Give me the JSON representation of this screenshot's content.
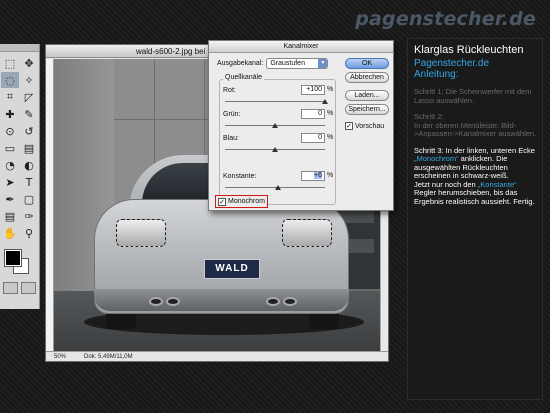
{
  "watermark": "pagenstecher.de",
  "document": {
    "title": "wald-s600-2.jpg bei 5",
    "status_zoom": "50%",
    "status_doc": "Dok: 5,49M/11,0M"
  },
  "scene": {
    "plate_text": "WALD"
  },
  "dialog": {
    "title": "Kanalmixer",
    "output_label": "Ausgabekanal:",
    "output_value": "Graustufen",
    "group_label": "Quellkanäle",
    "red_label": "Rot:",
    "red_value": "+100",
    "green_label": "Grün:",
    "green_value": "0",
    "blue_label": "Blau:",
    "blue_value": "0",
    "constant_label": "Konstante:",
    "constant_value": "+6",
    "percent": "%",
    "ok_label": "OK",
    "cancel_label": "Abbrechen",
    "load_label": "Laden...",
    "save_label": "Speichern...",
    "preview_label": "Vorschau",
    "preview_checked": true,
    "mono_label": "Monochrom",
    "mono_checked": true,
    "check_mark": "✓"
  },
  "panel": {
    "title": "Klarglas Rückleuchten",
    "subtitle_line1": "Pagenstecher.de",
    "subtitle_line2": "Anleitung:",
    "step1_title": "Schritt 1: Die Scheinwerfer mit dem Lasso auswählen.",
    "step2_title": "Schritt 2:",
    "step2_text": "In der oberen Menüleiste: Bild->Anpassen->Kanalmixer auswählen.",
    "step3_a": "Schritt 3: In der linken, unteren Ecke ",
    "step3_hl": "„Monochrom“",
    "step3_b": " anklicken. Die ausgewählten Rückleuchten erscheinen in schwarz-weiß.",
    "step4_a": "Jetzt nur noch den ",
    "step4_hl": "„Konstante“",
    "step4_b": " Regler herumschieben, bis das Ergebnis realistisch aussieht. Fertig."
  },
  "colors": {
    "accent": "#34a9e8",
    "highlight_red": "#d01818",
    "background": "#1b1b1b"
  },
  "tools": {
    "icons": [
      "marquee-icon",
      "move-icon",
      "lasso-icon",
      "magic-wand-icon",
      "crop-icon",
      "slice-icon",
      "healing-icon",
      "brush-icon",
      "stamp-icon",
      "history-brush-icon",
      "eraser-icon",
      "gradient-icon",
      "blur-icon",
      "dodge-icon",
      "path-select-icon",
      "type-icon",
      "pen-icon",
      "shape-icon",
      "notes-icon",
      "eyedropper-icon",
      "hand-icon",
      "zoom-icon"
    ],
    "glyphs": [
      "⬚",
      "✥",
      "◌",
      "✧",
      "⌗",
      "◸",
      "✚",
      "✎",
      "⊙",
      "↺",
      "▭",
      "▤",
      "◔",
      "◐",
      "➤",
      "T",
      "✒",
      "▢",
      "▤",
      "✑",
      "✋",
      "⚲"
    ]
  }
}
